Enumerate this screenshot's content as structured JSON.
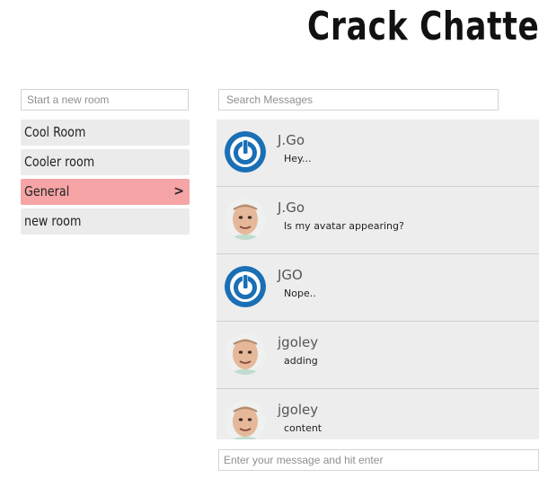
{
  "app": {
    "title": "Crack Chatter"
  },
  "rooms": {
    "new_room_placeholder": "Start a new room",
    "items": [
      {
        "label": "Cool Room",
        "active": false
      },
      {
        "label": "Cooler room",
        "active": false
      },
      {
        "label": "General",
        "active": true,
        "chevron": ">"
      },
      {
        "label": "new room",
        "active": false
      }
    ]
  },
  "search": {
    "placeholder": "Search Messages"
  },
  "messages": [
    {
      "user": "J.Go",
      "text": "Hey...",
      "avatar": "power-logo"
    },
    {
      "user": "J.Go",
      "text": "Is my avatar appearing?",
      "avatar": "face-photo"
    },
    {
      "user": "JGO",
      "text": "Nope..",
      "avatar": "power-logo"
    },
    {
      "user": "jgoley",
      "text": "adding",
      "avatar": "face-photo"
    },
    {
      "user": "jgoley",
      "text": "content",
      "avatar": "face-photo"
    }
  ],
  "composer": {
    "placeholder": "Enter your message and hit enter"
  },
  "colors": {
    "active_room": "#f6a4a5",
    "room_bg": "#ebebeb",
    "message_bg": "#ededed",
    "logo_blue": "#1a6fb5"
  }
}
